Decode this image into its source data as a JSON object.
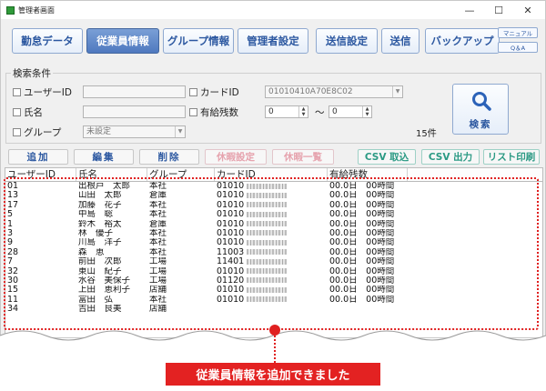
{
  "window": {
    "title": "管理者画面",
    "controls": [
      "—",
      "☐",
      "✕"
    ]
  },
  "toolbar": {
    "buttons": [
      "勤怠データ",
      "従業員情報",
      "グループ情報",
      "管理者設定",
      "送信設定",
      "送信",
      "バックアップ"
    ],
    "active": "従業員情報",
    "manual": "マニュアル",
    "qa": "Q＆A"
  },
  "search": {
    "title": "検索条件",
    "user_id_label": "ユーザーID",
    "user_id_value": "",
    "name_label": "氏名",
    "name_value": "",
    "group_label": "グループ",
    "group_value": "未設定",
    "card_id_label": "カードID",
    "card_id_value": "01010410A70E8C02",
    "paid_leave_label": "有給残数",
    "paid_leave_from": "0",
    "paid_leave_to": "0",
    "range_sep": "～",
    "count": "15件",
    "search_button": "検索",
    "search_icon": "magnifier-icon"
  },
  "actions": [
    "追加",
    "編集",
    "削除",
    "休暇設定",
    "休暇一覧",
    "CSV 取込",
    "CSV 出力",
    "リスト印刷"
  ],
  "table": {
    "headers": [
      "ユーザーID",
      "氏名",
      "グループ",
      "カードID",
      "有給残数"
    ],
    "rows": [
      {
        "id": "01",
        "name": "出根戸　太郎",
        "group": "本社",
        "card": "01010",
        "leave": "00.0日　00時間"
      },
      {
        "id": "13",
        "name": "山田　太郎",
        "group": "倉庫",
        "card": "01010",
        "leave": "00.0日　00時間"
      },
      {
        "id": "17",
        "name": "加藤　花子",
        "group": "本社",
        "card": "01010",
        "leave": "00.0日　00時間"
      },
      {
        "id": "5",
        "name": "中島　聡",
        "group": "本社",
        "card": "01010",
        "leave": "00.0日　00時間"
      },
      {
        "id": "1",
        "name": "鈴木　裕太",
        "group": "倉庫",
        "card": "01010",
        "leave": "00.0日　00時間"
      },
      {
        "id": "3",
        "name": "林　優子",
        "group": "本社",
        "card": "01010",
        "leave": "00.0日　00時間"
      },
      {
        "id": "9",
        "name": "川島　洋子",
        "group": "本社",
        "card": "01010",
        "leave": "00.0日　00時間"
      },
      {
        "id": "28",
        "name": "森　恵",
        "group": "本社",
        "card": "11003",
        "leave": "00.0日　00時間"
      },
      {
        "id": "7",
        "name": "前田　次郎",
        "group": "工場",
        "card": "11401",
        "leave": "00.0日　00時間"
      },
      {
        "id": "32",
        "name": "東山　紀子",
        "group": "工場",
        "card": "01010",
        "leave": "00.0日　00時間"
      },
      {
        "id": "30",
        "name": "水谷　美保子",
        "group": "工場",
        "card": "01120",
        "leave": "00.0日　00時間"
      },
      {
        "id": "15",
        "name": "上田　恵利子",
        "group": "店舗",
        "card": "01010",
        "leave": "00.0日　00時間"
      },
      {
        "id": "11",
        "name": "富田　弘",
        "group": "本社",
        "card": "01010",
        "leave": "00.0日　00時間"
      },
      {
        "id": "34",
        "name": "吉田　良美",
        "group": "店舗",
        "card": "",
        "leave": ""
      }
    ]
  },
  "callout": "従業員情報を追加できました",
  "colors": {
    "accent": "#4f79bf",
    "highlight": "#e02020"
  }
}
